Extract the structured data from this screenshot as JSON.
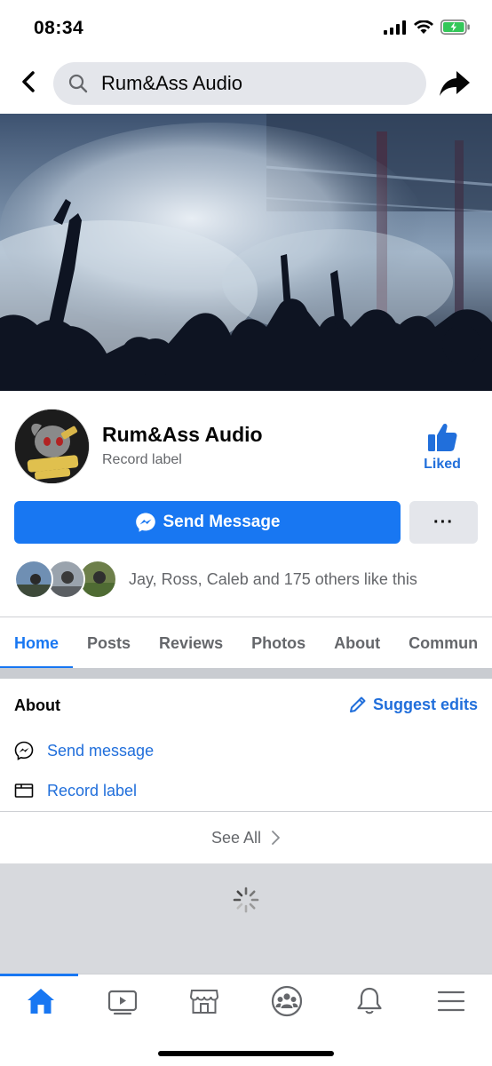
{
  "status_bar": {
    "time": "08:34"
  },
  "search": {
    "query": "Rum&Ass Audio"
  },
  "profile": {
    "name": "Rum&Ass Audio",
    "category": "Record label",
    "liked_label": "Liked",
    "send_message_label": "Send Message",
    "more_label": "···",
    "likes_text": "Jay, Ross, Caleb and 175 others like this"
  },
  "tabs": [
    {
      "label": "Home",
      "active": true
    },
    {
      "label": "Posts"
    },
    {
      "label": "Reviews"
    },
    {
      "label": "Photos"
    },
    {
      "label": "About"
    },
    {
      "label": "Commun"
    }
  ],
  "about": {
    "title": "About",
    "suggest_label": "Suggest edits",
    "items": [
      {
        "label": "Send message",
        "icon": "messenger-icon"
      },
      {
        "label": "Record label",
        "icon": "category-icon"
      }
    ],
    "see_all_label": "See All"
  },
  "bottom_nav": [
    "home-icon",
    "watch-icon",
    "marketplace-icon",
    "groups-icon",
    "notifications-icon",
    "menu-icon"
  ],
  "colors": {
    "accent": "#1877f2",
    "link": "#216fdb",
    "secondary_text": "#65676b"
  }
}
